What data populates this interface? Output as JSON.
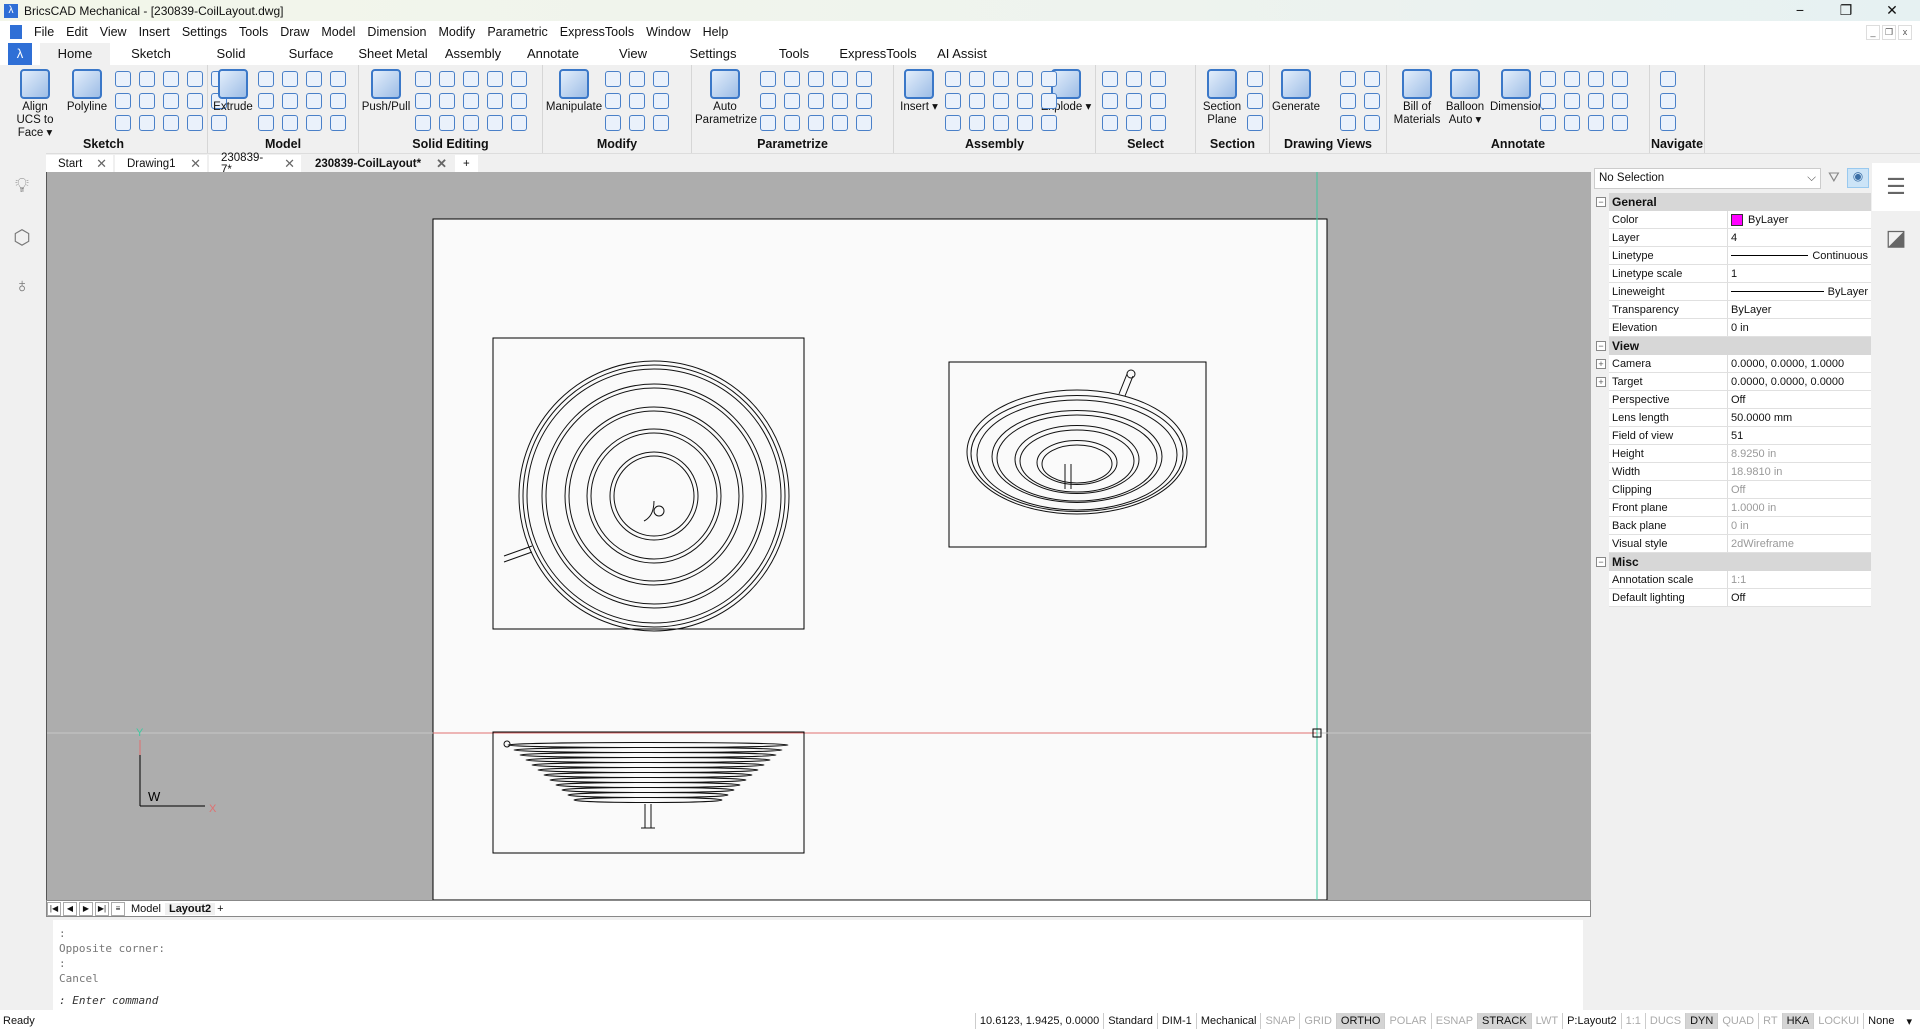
{
  "window": {
    "title": "BricsCAD Mechanical - [230839-CoilLayout.dwg]",
    "min": "−",
    "max": "❐",
    "close": "✕"
  },
  "menu": [
    "File",
    "Edit",
    "View",
    "Insert",
    "Settings",
    "Tools",
    "Draw",
    "Model",
    "Dimension",
    "Modify",
    "Parametric",
    "ExpressTools",
    "Window",
    "Help"
  ],
  "ribbon_tabs": [
    {
      "label": "Home",
      "active": true
    },
    {
      "label": "Sketch"
    },
    {
      "label": "Solid"
    },
    {
      "label": "Surface"
    },
    {
      "label": "Sheet Metal"
    },
    {
      "label": "Assembly"
    },
    {
      "label": "Annotate"
    },
    {
      "label": "View"
    },
    {
      "label": "Settings"
    },
    {
      "label": "Tools"
    },
    {
      "label": "ExpressTools"
    },
    {
      "label": "AI Assist"
    }
  ],
  "ribbon_groups": [
    {
      "label": "Sketch",
      "buttons": [
        "Align UCS to Face ▾",
        "Polyline"
      ]
    },
    {
      "label": "Model",
      "buttons": [
        "Extrude"
      ]
    },
    {
      "label": "Solid Editing",
      "buttons": [
        "Push/Pull"
      ]
    },
    {
      "label": "Modify",
      "buttons": [
        "Manipulate"
      ]
    },
    {
      "label": "Parametrize",
      "buttons": [
        "Auto Parametrize"
      ]
    },
    {
      "label": "Assembly",
      "buttons": [
        "Insert ▾",
        "Explode ▾"
      ]
    },
    {
      "label": "Select",
      "buttons": []
    },
    {
      "label": "Section",
      "buttons": [
        "Section Plane"
      ]
    },
    {
      "label": "Drawing Views",
      "buttons": [
        "Generate"
      ]
    },
    {
      "label": "Annotate",
      "buttons": [
        "Bill of Materials",
        "Balloon Auto ▾",
        "Dimension"
      ]
    },
    {
      "label": "Navigate",
      "buttons": []
    }
  ],
  "doc_tabs": [
    {
      "label": "Start"
    },
    {
      "label": "Drawing1"
    },
    {
      "label": "230839-7*"
    },
    {
      "label": "230839-CoilLayout*",
      "active": true
    }
  ],
  "doc_tab_close": "✕",
  "doc_tab_add": "+",
  "layout_tabs": {
    "model": "Model",
    "active": "Layout2",
    "add": "+"
  },
  "ucs": {
    "y": "Y",
    "x": "X",
    "w": "W"
  },
  "command": {
    "lines": [
      ":",
      "Opposite corner:",
      ":",
      "Cancel"
    ],
    "prompt": ": Enter command"
  },
  "status": {
    "ready": "Ready",
    "coords": "10.6123, 1.9425, 0.0000",
    "fields": [
      {
        "t": "Standard"
      },
      {
        "t": "DIM-1"
      },
      {
        "t": "Mechanical"
      },
      {
        "t": "SNAP",
        "s": "off"
      },
      {
        "t": "GRID",
        "s": "off"
      },
      {
        "t": "ORTHO",
        "s": "on"
      },
      {
        "t": "POLAR",
        "s": "off"
      },
      {
        "t": "ESNAP",
        "s": "off"
      },
      {
        "t": "STRACK",
        "s": "on"
      },
      {
        "t": "LWT",
        "s": "off"
      },
      {
        "t": "P:Layout2"
      },
      {
        "t": "1:1",
        "s": "off"
      },
      {
        "t": "DUCS",
        "s": "off"
      },
      {
        "t": "DYN",
        "s": "on"
      },
      {
        "t": "QUAD",
        "s": "off"
      },
      {
        "t": "RT",
        "s": "off"
      },
      {
        "t": "HKA",
        "s": "on"
      },
      {
        "t": "LOCKUI",
        "s": "off"
      },
      {
        "t": "None"
      }
    ]
  },
  "properties": {
    "selection": "No Selection",
    "sections": [
      {
        "title": "General",
        "rows": [
          [
            "Color",
            "ByLayer"
          ],
          [
            "Layer",
            "4"
          ],
          [
            "Linetype",
            "Continuous"
          ],
          [
            "Linetype scale",
            "1"
          ],
          [
            "Lineweight",
            "ByLayer"
          ],
          [
            "Transparency",
            "ByLayer"
          ],
          [
            "Elevation",
            "0 in"
          ]
        ]
      },
      {
        "title": "View",
        "rows": [
          [
            "Camera",
            "0.0000, 0.0000, 1.0000"
          ],
          [
            "Target",
            "0.0000, 0.0000, 0.0000"
          ],
          [
            "Perspective",
            "Off"
          ],
          [
            "Lens length",
            "50.0000 mm"
          ],
          [
            "Field of view",
            "51"
          ],
          [
            "Height",
            "8.9250 in"
          ],
          [
            "Width",
            "18.9810 in"
          ],
          [
            "Clipping",
            "Off"
          ],
          [
            "Front plane",
            "1.0000 in"
          ],
          [
            "Back plane",
            "0 in"
          ],
          [
            "Visual style",
            "2dWireframe"
          ]
        ]
      },
      {
        "title": "Misc",
        "rows": [
          [
            "Annotation scale",
            "1:1"
          ],
          [
            "Default lighting",
            "Off"
          ]
        ]
      }
    ],
    "color_swatch": "#ff00ff"
  },
  "colors": {
    "accent": "#2f6fd6",
    "crosshair_x": "#e07070",
    "crosshair_y": "#40c8a0"
  }
}
